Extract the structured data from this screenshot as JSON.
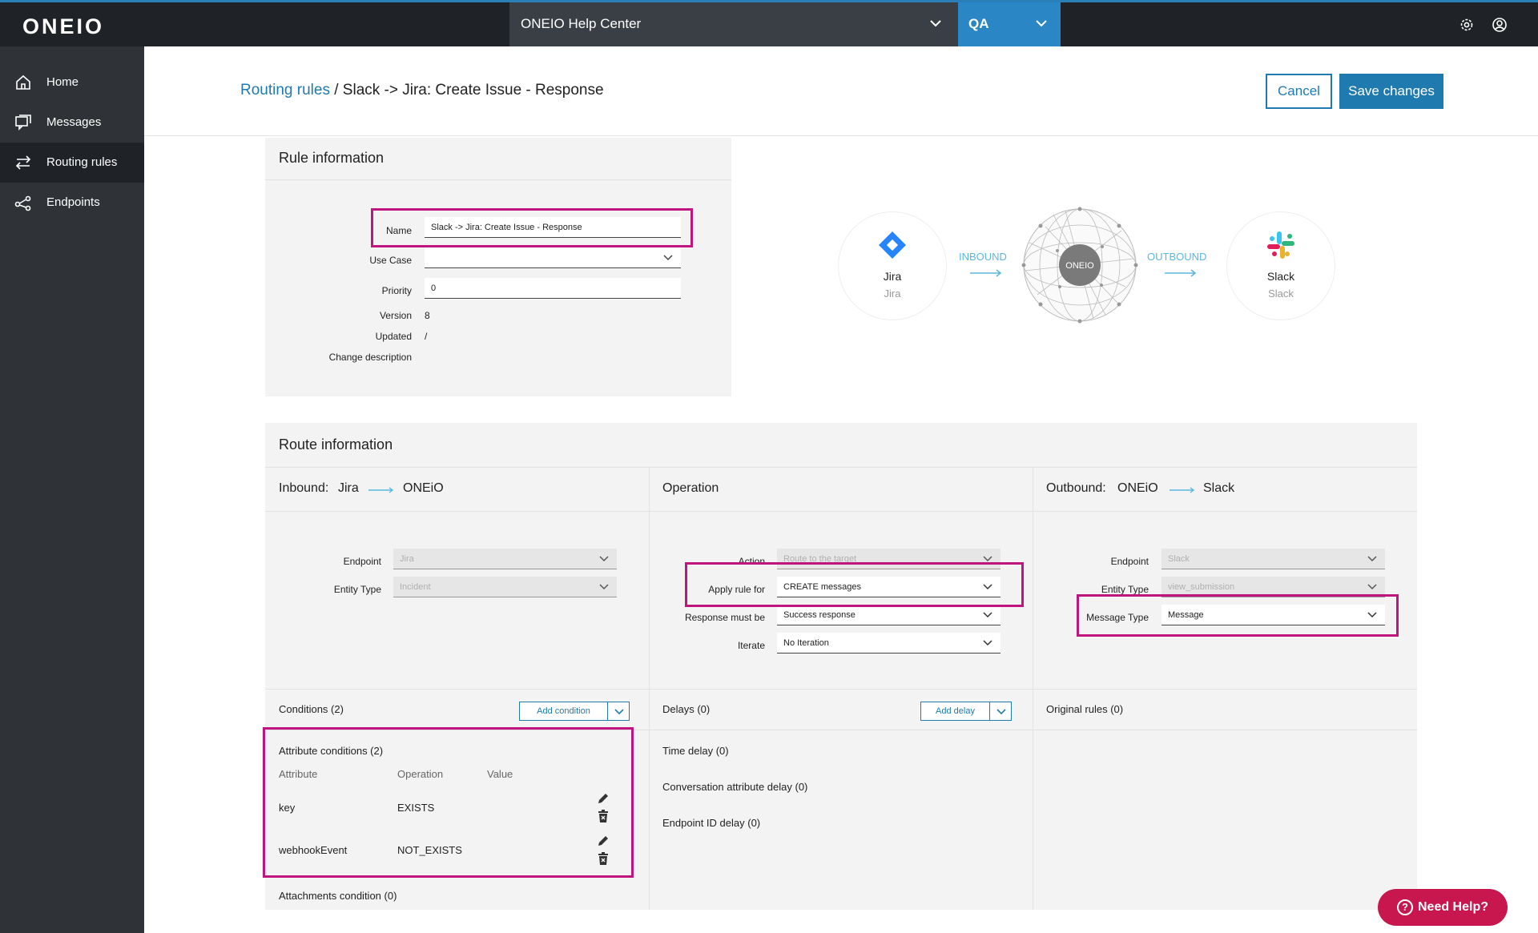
{
  "topbar": {
    "logo": "ONEIO",
    "org_select": "ONEIO Help Center",
    "env_select": "QA"
  },
  "sidebar": {
    "items": [
      {
        "label": "Home",
        "icon": "home-icon"
      },
      {
        "label": "Messages",
        "icon": "messages-icon"
      },
      {
        "label": "Routing rules",
        "icon": "routing-icon"
      },
      {
        "label": "Endpoints",
        "icon": "endpoints-icon"
      }
    ]
  },
  "header": {
    "breadcrumb_link": "Routing rules",
    "breadcrumb_sep": " / ",
    "breadcrumb_current": "Slack -> Jira: Create Issue - Response",
    "cancel_label": "Cancel",
    "save_label": "Save changes"
  },
  "rule_info": {
    "title": "Rule information",
    "name_label": "Name",
    "name_value": "Slack -> Jira: Create Issue - Response",
    "use_case_label": "Use Case",
    "use_case_value": "",
    "priority_label": "Priority",
    "priority_value": "0",
    "version_label": "Version",
    "version_value": "8",
    "updated_label": "Updated",
    "updated_value": "/",
    "change_desc_label": "Change description"
  },
  "flow": {
    "source_name": "Jira",
    "source_sub": "Jira",
    "inbound_label": "INBOUND",
    "hub_label": "ONEIO",
    "outbound_label": "OUTBOUND",
    "target_name": "Slack",
    "target_sub": "Slack"
  },
  "route_info": {
    "title": "Route information",
    "inbound": {
      "title_prefix": "Inbound:",
      "from": "Jira",
      "to": "ONEiO",
      "endpoint_label": "Endpoint",
      "endpoint_value": "Jira",
      "entity_type_label": "Entity Type",
      "entity_type_value": "Incident"
    },
    "operation": {
      "title": "Operation",
      "action_label": "Action",
      "action_value": "Route to the target",
      "apply_label": "Apply rule for",
      "apply_value": "CREATE messages",
      "response_label": "Response must be",
      "response_value": "Success response",
      "iterate_label": "Iterate",
      "iterate_value": "No Iteration"
    },
    "outbound": {
      "title_prefix": "Outbound:",
      "from": "ONEiO",
      "to": "Slack",
      "endpoint_label": "Endpoint",
      "endpoint_value": "Slack",
      "entity_type_label": "Entity Type",
      "entity_type_value": "view_submission",
      "message_type_label": "Message Type",
      "message_type_value": "Message"
    }
  },
  "conditions": {
    "title": "Conditions (2)",
    "add_label": "Add condition",
    "attr_title": "Attribute conditions (2)",
    "headers": [
      "Attribute",
      "Operation",
      "Value"
    ],
    "rows": [
      {
        "attribute": "key",
        "operation": "EXISTS",
        "value": ""
      },
      {
        "attribute": "webhookEvent",
        "operation": "NOT_EXISTS",
        "value": ""
      }
    ],
    "attachments_title": "Attachments condition (0)"
  },
  "delays": {
    "title": "Delays (0)",
    "add_label": "Add delay",
    "time_delay": "Time delay (0)",
    "conv_delay": "Conversation attribute delay (0)",
    "endpoint_delay": "Endpoint ID delay (0)"
  },
  "original_rules": {
    "title": "Original rules (0)"
  },
  "help": {
    "label": "Need Help?"
  },
  "colors": {
    "accent": "#1f7ab0",
    "highlight": "#c0157f",
    "sidebar": "#2f3338",
    "help": "#c8174f"
  }
}
